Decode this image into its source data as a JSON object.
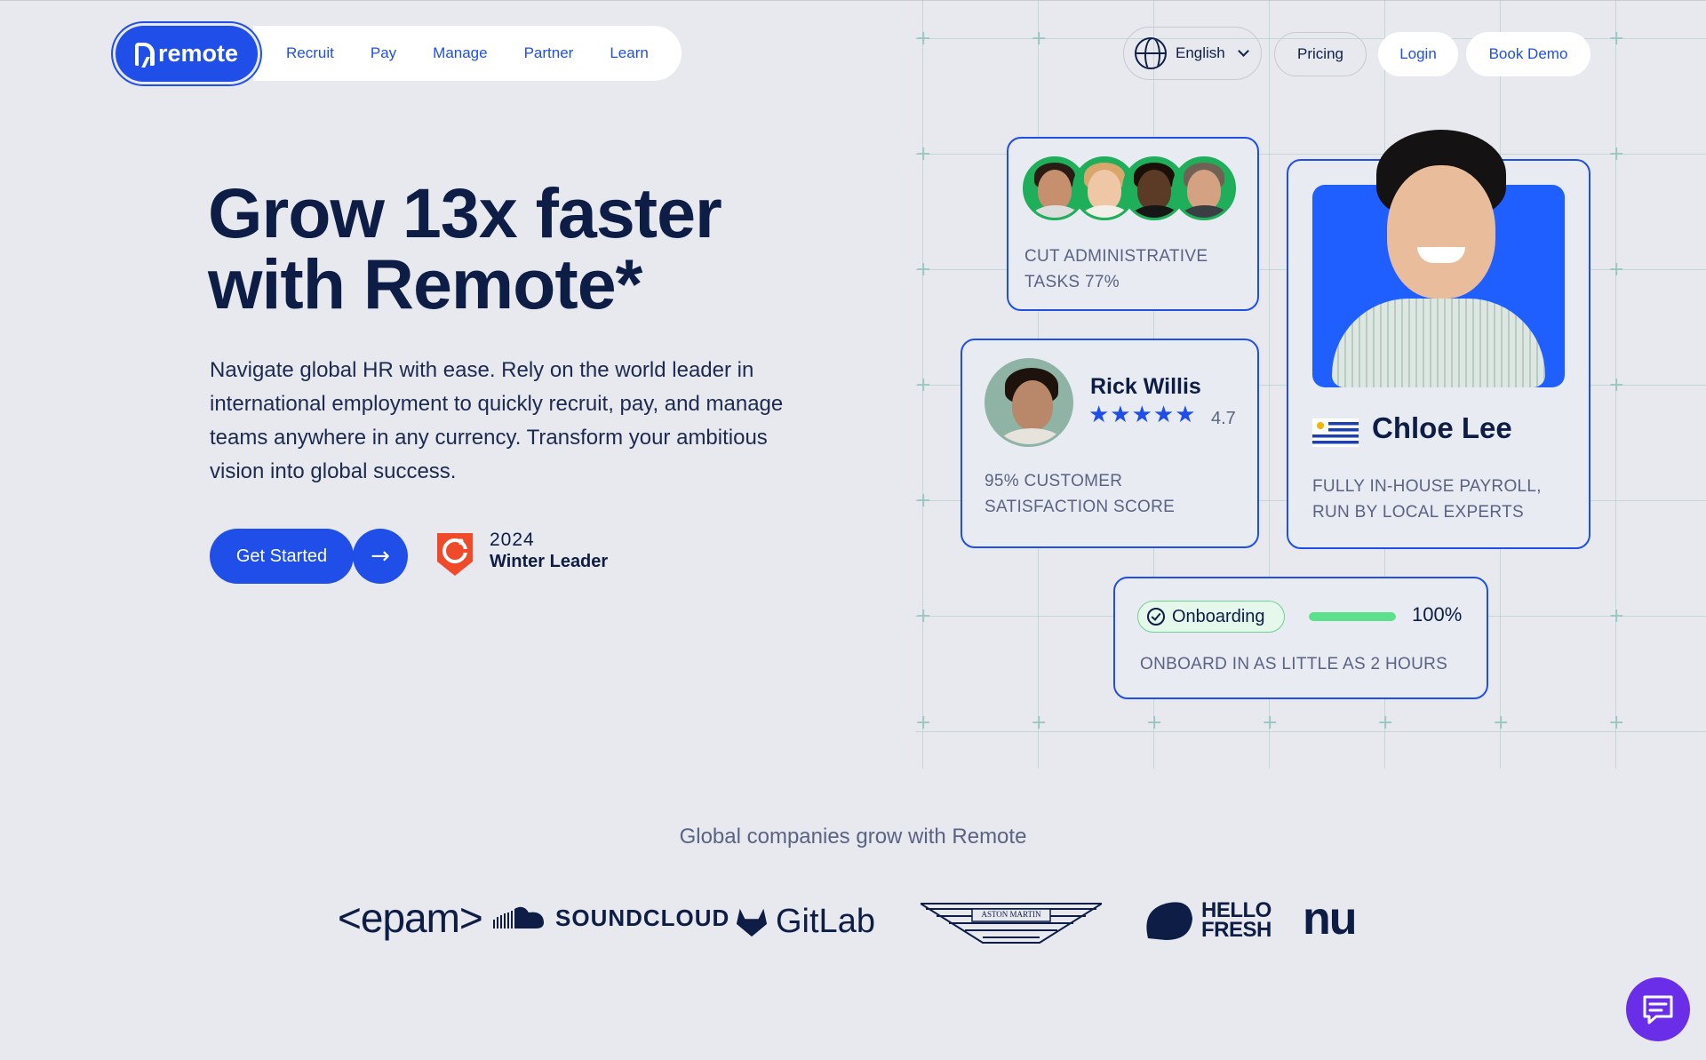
{
  "nav": {
    "brand": "remote",
    "links": [
      "Recruit",
      "Pay",
      "Manage",
      "Partner",
      "Learn"
    ],
    "language": "English",
    "pricing": "Pricing",
    "login": "Login",
    "book_demo": "Book Demo"
  },
  "hero": {
    "title_line1": "Grow 13x faster",
    "title_line2": "with Remote*",
    "subtitle": "Navigate global HR with ease. Rely on the world leader in international employment to quickly recruit, pay, and manage teams anywhere in any currency. Transform your ambitious vision into global success.",
    "cta_label": "Get Started",
    "badge_year": "2024",
    "badge_title": "Winter Leader"
  },
  "cards": {
    "admin": {
      "text": "CUT ADMINISTRATIVE TASKS 77%"
    },
    "rating": {
      "name": "Rick Willis",
      "rating": "4.7",
      "stars": "★★★★★",
      "text": "95% CUSTOMER SATISFACTION SCORE"
    },
    "profile": {
      "name": "Chloe Lee",
      "text": "FULLY IN-HOUSE PAYROLL, RUN BY LOCAL EXPERTS"
    },
    "onboarding": {
      "tag": "Onboarding",
      "progress": 1.0,
      "percent": "100%",
      "text": "ONBOARD IN AS LITTLE AS 2 HOURS"
    }
  },
  "companies": {
    "title": "Global companies grow with Remote",
    "logos": [
      "<epam>",
      "SOUNDCLOUD",
      "GitLab",
      "ASTON MARTIN",
      "HELLO FRESH",
      "nu"
    ]
  },
  "colors": {
    "brand_blue": "#1f4fe8",
    "navy": "#0d1d45",
    "green": "#1faf5b",
    "chat_purple": "#6b2ee8",
    "background": "#e7e9ef"
  },
  "icons": [
    "globe-icon",
    "chevron-down-icon",
    "arrow-right-icon",
    "g2-badge-icon",
    "check-circle-icon",
    "chat-icon",
    "uruguay-flag-icon"
  ]
}
